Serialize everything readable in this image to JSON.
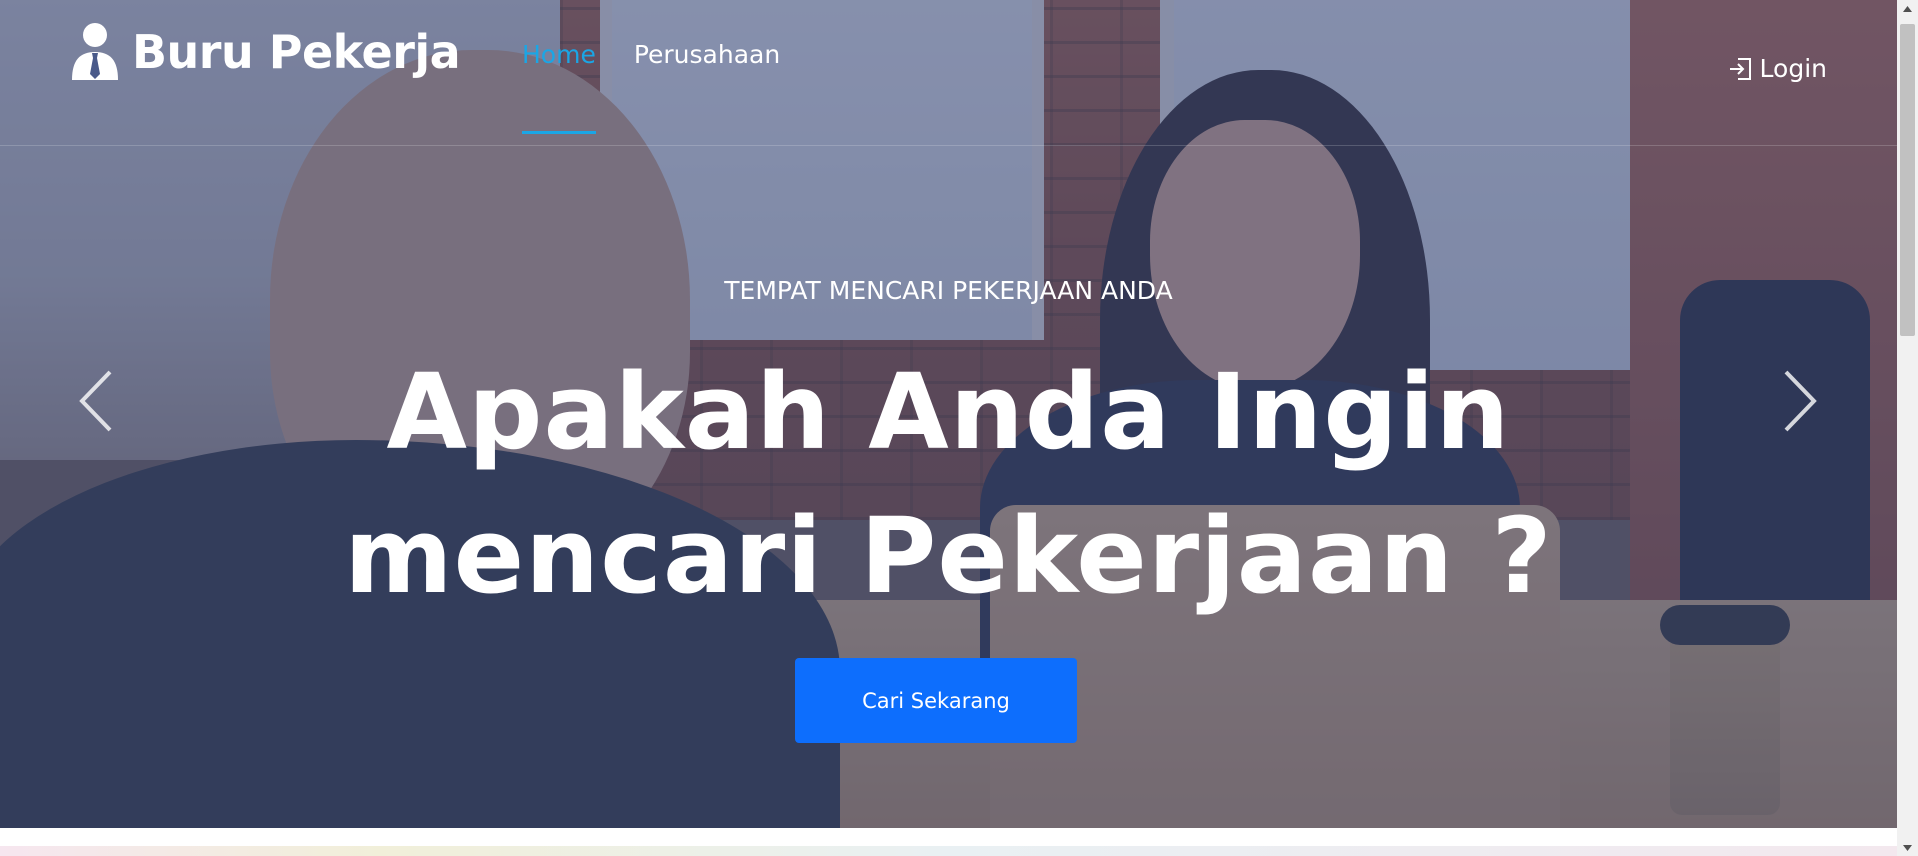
{
  "brand": {
    "name": "Buru Pekerja",
    "icon": "user-tie-icon"
  },
  "nav": {
    "items": [
      {
        "label": "Home",
        "active": true
      },
      {
        "label": "Perusahaan",
        "active": false
      }
    ],
    "login_label": "Login",
    "login_icon": "sign-in-icon"
  },
  "hero": {
    "tagline": "TEMPAT MENCARI PEKERJAAN ANDA",
    "headline_line1": "Apakah Anda Ingin",
    "headline_line2": "mencari Pekerjaan ?",
    "cta_label": "Cari Sekarang",
    "prev_icon": "chevron-left-icon",
    "next_icon": "chevron-right-icon"
  },
  "colors": {
    "accent": "#1ba6e5",
    "button": "#0d6efd",
    "text": "#ffffff",
    "overlay": "#3a4878"
  }
}
